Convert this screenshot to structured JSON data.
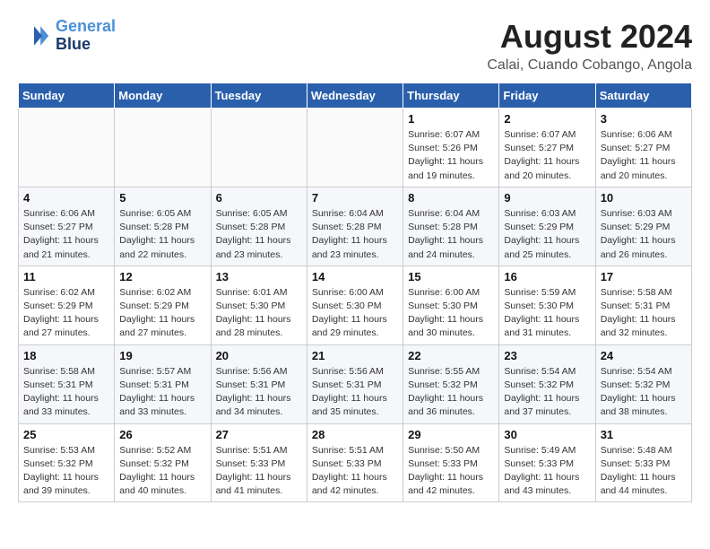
{
  "header": {
    "logo_line1": "General",
    "logo_line2": "Blue",
    "title": "August 2024",
    "subtitle": "Calai, Cuando Cobango, Angola"
  },
  "weekdays": [
    "Sunday",
    "Monday",
    "Tuesday",
    "Wednesday",
    "Thursday",
    "Friday",
    "Saturday"
  ],
  "weeks": [
    [
      {
        "day": "",
        "info": ""
      },
      {
        "day": "",
        "info": ""
      },
      {
        "day": "",
        "info": ""
      },
      {
        "day": "",
        "info": ""
      },
      {
        "day": "1",
        "info": "Sunrise: 6:07 AM\nSunset: 5:26 PM\nDaylight: 11 hours\nand 19 minutes."
      },
      {
        "day": "2",
        "info": "Sunrise: 6:07 AM\nSunset: 5:27 PM\nDaylight: 11 hours\nand 20 minutes."
      },
      {
        "day": "3",
        "info": "Sunrise: 6:06 AM\nSunset: 5:27 PM\nDaylight: 11 hours\nand 20 minutes."
      }
    ],
    [
      {
        "day": "4",
        "info": "Sunrise: 6:06 AM\nSunset: 5:27 PM\nDaylight: 11 hours\nand 21 minutes."
      },
      {
        "day": "5",
        "info": "Sunrise: 6:05 AM\nSunset: 5:28 PM\nDaylight: 11 hours\nand 22 minutes."
      },
      {
        "day": "6",
        "info": "Sunrise: 6:05 AM\nSunset: 5:28 PM\nDaylight: 11 hours\nand 23 minutes."
      },
      {
        "day": "7",
        "info": "Sunrise: 6:04 AM\nSunset: 5:28 PM\nDaylight: 11 hours\nand 23 minutes."
      },
      {
        "day": "8",
        "info": "Sunrise: 6:04 AM\nSunset: 5:28 PM\nDaylight: 11 hours\nand 24 minutes."
      },
      {
        "day": "9",
        "info": "Sunrise: 6:03 AM\nSunset: 5:29 PM\nDaylight: 11 hours\nand 25 minutes."
      },
      {
        "day": "10",
        "info": "Sunrise: 6:03 AM\nSunset: 5:29 PM\nDaylight: 11 hours\nand 26 minutes."
      }
    ],
    [
      {
        "day": "11",
        "info": "Sunrise: 6:02 AM\nSunset: 5:29 PM\nDaylight: 11 hours\nand 27 minutes."
      },
      {
        "day": "12",
        "info": "Sunrise: 6:02 AM\nSunset: 5:29 PM\nDaylight: 11 hours\nand 27 minutes."
      },
      {
        "day": "13",
        "info": "Sunrise: 6:01 AM\nSunset: 5:30 PM\nDaylight: 11 hours\nand 28 minutes."
      },
      {
        "day": "14",
        "info": "Sunrise: 6:00 AM\nSunset: 5:30 PM\nDaylight: 11 hours\nand 29 minutes."
      },
      {
        "day": "15",
        "info": "Sunrise: 6:00 AM\nSunset: 5:30 PM\nDaylight: 11 hours\nand 30 minutes."
      },
      {
        "day": "16",
        "info": "Sunrise: 5:59 AM\nSunset: 5:30 PM\nDaylight: 11 hours\nand 31 minutes."
      },
      {
        "day": "17",
        "info": "Sunrise: 5:58 AM\nSunset: 5:31 PM\nDaylight: 11 hours\nand 32 minutes."
      }
    ],
    [
      {
        "day": "18",
        "info": "Sunrise: 5:58 AM\nSunset: 5:31 PM\nDaylight: 11 hours\nand 33 minutes."
      },
      {
        "day": "19",
        "info": "Sunrise: 5:57 AM\nSunset: 5:31 PM\nDaylight: 11 hours\nand 33 minutes."
      },
      {
        "day": "20",
        "info": "Sunrise: 5:56 AM\nSunset: 5:31 PM\nDaylight: 11 hours\nand 34 minutes."
      },
      {
        "day": "21",
        "info": "Sunrise: 5:56 AM\nSunset: 5:31 PM\nDaylight: 11 hours\nand 35 minutes."
      },
      {
        "day": "22",
        "info": "Sunrise: 5:55 AM\nSunset: 5:32 PM\nDaylight: 11 hours\nand 36 minutes."
      },
      {
        "day": "23",
        "info": "Sunrise: 5:54 AM\nSunset: 5:32 PM\nDaylight: 11 hours\nand 37 minutes."
      },
      {
        "day": "24",
        "info": "Sunrise: 5:54 AM\nSunset: 5:32 PM\nDaylight: 11 hours\nand 38 minutes."
      }
    ],
    [
      {
        "day": "25",
        "info": "Sunrise: 5:53 AM\nSunset: 5:32 PM\nDaylight: 11 hours\nand 39 minutes."
      },
      {
        "day": "26",
        "info": "Sunrise: 5:52 AM\nSunset: 5:32 PM\nDaylight: 11 hours\nand 40 minutes."
      },
      {
        "day": "27",
        "info": "Sunrise: 5:51 AM\nSunset: 5:33 PM\nDaylight: 11 hours\nand 41 minutes."
      },
      {
        "day": "28",
        "info": "Sunrise: 5:51 AM\nSunset: 5:33 PM\nDaylight: 11 hours\nand 42 minutes."
      },
      {
        "day": "29",
        "info": "Sunrise: 5:50 AM\nSunset: 5:33 PM\nDaylight: 11 hours\nand 42 minutes."
      },
      {
        "day": "30",
        "info": "Sunrise: 5:49 AM\nSunset: 5:33 PM\nDaylight: 11 hours\nand 43 minutes."
      },
      {
        "day": "31",
        "info": "Sunrise: 5:48 AM\nSunset: 5:33 PM\nDaylight: 11 hours\nand 44 minutes."
      }
    ]
  ]
}
